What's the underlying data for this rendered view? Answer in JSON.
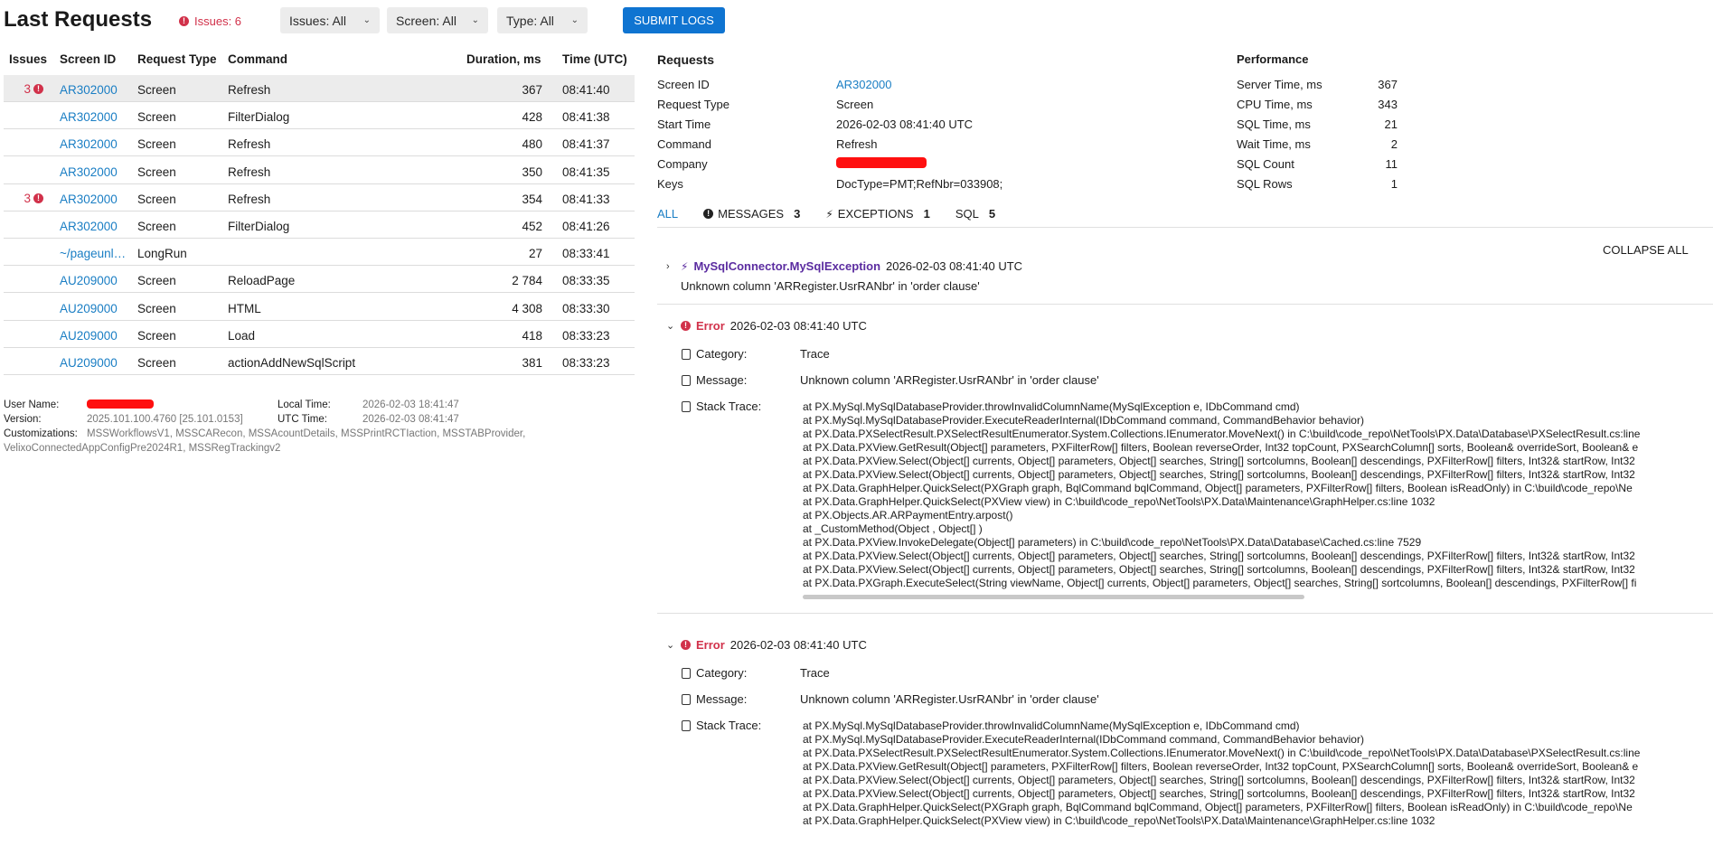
{
  "header": {
    "title": "Last Requests",
    "issues_label": "Issues: 6",
    "filters": [
      {
        "label": "Issues: All"
      },
      {
        "label": "Screen: All"
      },
      {
        "label": "Type: All"
      }
    ],
    "submit_label": "SUBMIT LOGS"
  },
  "table": {
    "columns": [
      "Issues",
      "Screen ID",
      "Request Type",
      "Command",
      "Duration, ms",
      "Time (UTC)"
    ],
    "rows": [
      {
        "issues": "3",
        "screen": "AR302000",
        "type": "Screen",
        "command": "Refresh",
        "duration": "367",
        "time": "08:41:40",
        "selected": true
      },
      {
        "issues": "",
        "screen": "AR302000",
        "type": "Screen",
        "command": "FilterDialog",
        "duration": "428",
        "time": "08:41:38"
      },
      {
        "issues": "",
        "screen": "AR302000",
        "type": "Screen",
        "command": "Refresh",
        "duration": "480",
        "time": "08:41:37"
      },
      {
        "issues": "",
        "screen": "AR302000",
        "type": "Screen",
        "command": "Refresh",
        "duration": "350",
        "time": "08:41:35"
      },
      {
        "issues": "3",
        "screen": "AR302000",
        "type": "Screen",
        "command": "Refresh",
        "duration": "354",
        "time": "08:41:33"
      },
      {
        "issues": "",
        "screen": "AR302000",
        "type": "Screen",
        "command": "FilterDialog",
        "duration": "452",
        "time": "08:41:26"
      },
      {
        "issues": "",
        "screen": "~/pageunl…",
        "type": "LongRun",
        "command": "",
        "duration": "27",
        "time": "08:33:41"
      },
      {
        "issues": "",
        "screen": "AU209000",
        "type": "Screen",
        "command": "ReloadPage",
        "duration": "2 784",
        "time": "08:33:35"
      },
      {
        "issues": "",
        "screen": "AU209000",
        "type": "Screen",
        "command": "HTML",
        "duration": "4 308",
        "time": "08:33:30"
      },
      {
        "issues": "",
        "screen": "AU209000",
        "type": "Screen",
        "command": "Load",
        "duration": "418",
        "time": "08:33:23"
      },
      {
        "issues": "",
        "screen": "AU209000",
        "type": "Screen",
        "command": "actionAddNewSqlScript",
        "duration": "381",
        "time": "08:33:23"
      }
    ]
  },
  "footer": {
    "user_name_label": "User Name:",
    "version_label": "Version:",
    "version_value": "2025.101.100.4760 [25.101.0153]",
    "customizations_label": "Customizations:",
    "customizations_line1": "MSSWorkflowsV1, MSSCARecon, MSSAcountDetails, MSSPrintRCTIaction, MSSTABProvider,",
    "customizations_line2": "VelixoConnectedAppConfigPre2024R1, MSSRegTrackingv2",
    "local_time_label": "Local Time:",
    "local_time_value": "2026-02-03 18:41:47",
    "utc_time_label": "UTC Time:",
    "utc_time_value": "2026-02-03 08:41:47"
  },
  "requests": {
    "title": "Requests",
    "fields": [
      {
        "label": "Screen ID",
        "value": "AR302000"
      },
      {
        "label": "Request Type",
        "value": "Screen"
      },
      {
        "label": "Start Time",
        "value": "2026-02-03 08:41:40 UTC"
      },
      {
        "label": "Command",
        "value": "Refresh"
      },
      {
        "label": "Company",
        "value": ""
      },
      {
        "label": "Keys",
        "value": "DocType=PMT;RefNbr=033908;"
      }
    ]
  },
  "performance": {
    "title": "Performance",
    "fields": [
      {
        "label": "Server Time, ms",
        "value": "367"
      },
      {
        "label": "CPU Time, ms",
        "value": "343"
      },
      {
        "label": "SQL Time, ms",
        "value": "21"
      },
      {
        "label": "Wait Time, ms",
        "value": "2"
      },
      {
        "label": "SQL Count",
        "value": "11"
      },
      {
        "label": "SQL Rows",
        "value": "1"
      }
    ]
  },
  "tabs": {
    "all": "ALL",
    "messages": "MESSAGES",
    "messages_count": "3",
    "exceptions": "EXCEPTIONS",
    "exceptions_count": "1",
    "sql": "SQL",
    "sql_count": "5"
  },
  "collapse_all": "COLLAPSE ALL",
  "exception": {
    "name": "MySqlConnector.MySqlException",
    "time": "2026-02-03 08:41:40 UTC",
    "message": "Unknown column 'ARRegister.UsrRANbr' in 'order clause'"
  },
  "errors": [
    {
      "label": "Error",
      "time": "2026-02-03 08:41:40 UTC",
      "category_label": "Category:",
      "category": "Trace",
      "message_label": "Message:",
      "message": "Unknown column 'ARRegister.UsrRANbr' in 'order clause'",
      "stack_label": "Stack Trace:",
      "stack": "at PX.MySql.MySqlDatabaseProvider.throwInvalidColumnName(MySqlException e, IDbCommand cmd)\nat PX.MySql.MySqlDatabaseProvider.ExecuteReaderInternal(IDbCommand command, CommandBehavior behavior)\nat PX.Data.PXSelectResult.PXSelectResultEnumerator.System.Collections.IEnumerator.MoveNext() in C:\\build\\code_repo\\NetTools\\PX.Data\\Database\\PXSelectResult.cs:line\nat PX.Data.PXView.GetResult(Object[] parameters, PXFilterRow[] filters, Boolean reverseOrder, Int32 topCount, PXSearchColumn[] sorts, Boolean& overrideSort, Boolean& e\nat PX.Data.PXView.Select(Object[] currents, Object[] parameters, Object[] searches, String[] sortcolumns, Boolean[] descendings, PXFilterRow[] filters, Int32& startRow, Int32\nat PX.Data.PXView.Select(Object[] currents, Object[] parameters, Object[] searches, String[] sortcolumns, Boolean[] descendings, PXFilterRow[] filters, Int32& startRow, Int32\nat PX.Data.GraphHelper.QuickSelect(PXGraph graph, BqlCommand bqlCommand, Object[] parameters, PXFilterRow[] filters, Boolean isReadOnly) in C:\\build\\code_repo\\Ne\nat PX.Data.GraphHelper.QuickSelect(PXView view) in C:\\build\\code_repo\\NetTools\\PX.Data\\Maintenance\\GraphHelper.cs:line 1032\nat PX.Objects.AR.ARPaymentEntry.arpost()\nat _CustomMethod(Object , Object[] )\nat PX.Data.PXView.InvokeDelegate(Object[] parameters) in C:\\build\\code_repo\\NetTools\\PX.Data\\Database\\Cached.cs:line 7529\nat PX.Data.PXView.Select(Object[] currents, Object[] parameters, Object[] searches, String[] sortcolumns, Boolean[] descendings, PXFilterRow[] filters, Int32& startRow, Int32\nat PX.Data.PXView.Select(Object[] currents, Object[] parameters, Object[] searches, String[] sortcolumns, Boolean[] descendings, PXFilterRow[] filters, Int32& startRow, Int32\nat PX.Data.PXGraph.ExecuteSelect(String viewName, Object[] currents, Object[] parameters, Object[] searches, String[] sortcolumns, Boolean[] descendings, PXFilterRow[] fi"
    },
    {
      "label": "Error",
      "time": "2026-02-03 08:41:40 UTC",
      "category_label": "Category:",
      "category": "Trace",
      "message_label": "Message:",
      "message": "Unknown column 'ARRegister.UsrRANbr' in 'order clause'",
      "stack_label": "Stack Trace:",
      "stack": "at PX.MySql.MySqlDatabaseProvider.throwInvalidColumnName(MySqlException e, IDbCommand cmd)\nat PX.MySql.MySqlDatabaseProvider.ExecuteReaderInternal(IDbCommand command, CommandBehavior behavior)\nat PX.Data.PXSelectResult.PXSelectResultEnumerator.System.Collections.IEnumerator.MoveNext() in C:\\build\\code_repo\\NetTools\\PX.Data\\Database\\PXSelectResult.cs:line\nat PX.Data.PXView.GetResult(Object[] parameters, PXFilterRow[] filters, Boolean reverseOrder, Int32 topCount, PXSearchColumn[] sorts, Boolean& overrideSort, Boolean& e\nat PX.Data.PXView.Select(Object[] currents, Object[] parameters, Object[] searches, String[] sortcolumns, Boolean[] descendings, PXFilterRow[] filters, Int32& startRow, Int32\nat PX.Data.PXView.Select(Object[] currents, Object[] parameters, Object[] searches, String[] sortcolumns, Boolean[] descendings, PXFilterRow[] filters, Int32& startRow, Int32\nat PX.Data.GraphHelper.QuickSelect(PXGraph graph, BqlCommand bqlCommand, Object[] parameters, PXFilterRow[] filters, Boolean isReadOnly) in C:\\build\\code_repo\\Ne\nat PX.Data.GraphHelper.QuickSelect(PXView view) in C:\\build\\code_repo\\NetTools\\PX.Data\\Maintenance\\GraphHelper.cs:line 1032"
    }
  ]
}
